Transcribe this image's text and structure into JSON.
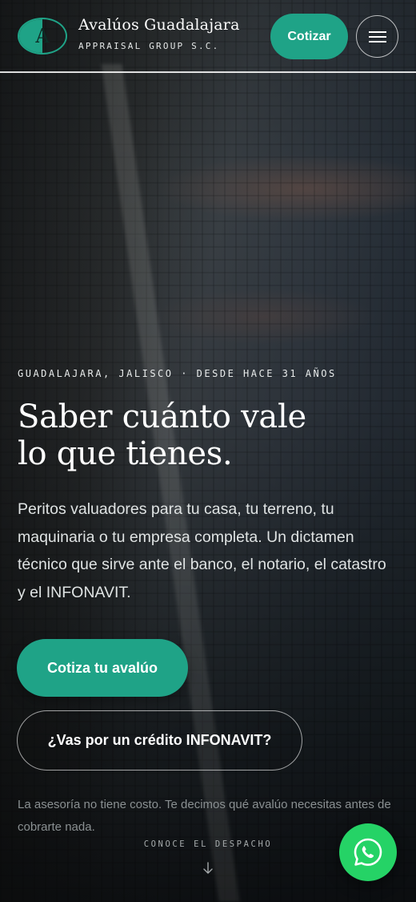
{
  "header": {
    "logo_letter": "A",
    "brand_name": "Avalúos Guadalajara",
    "brand_sub": "APPRAISAL GROUP S.C.",
    "cta_label": "Cotizar"
  },
  "hero": {
    "kicker": "GUADALAJARA, JALISCO · DESDE HACE 31 AÑOS",
    "headline_line1": "Saber cuánto vale",
    "headline_line2": "lo que tienes.",
    "intro": "Peritos valuadores para tu casa, tu terreno, tu maquinaria o tu empresa completa. Un dictamen técnico que sirve ante el banco, el notario, el catastro y el INFONAVIT.",
    "primary_cta": "Cotiza tu avalúo",
    "secondary_cta": "¿Vas por un crédito INFONAVIT?",
    "note": "La asesoría no tiene costo. Te decimos qué avalúo necesitas antes de cobrarte nada.",
    "scroll_label": "CONOCE EL DESPACHO"
  },
  "icons": {
    "menu": "hamburger-menu-icon",
    "scroll": "arrow-down-icon",
    "whatsapp": "whatsapp-icon"
  },
  "colors": {
    "accent": "#1fa387",
    "whatsapp": "#25d366"
  }
}
